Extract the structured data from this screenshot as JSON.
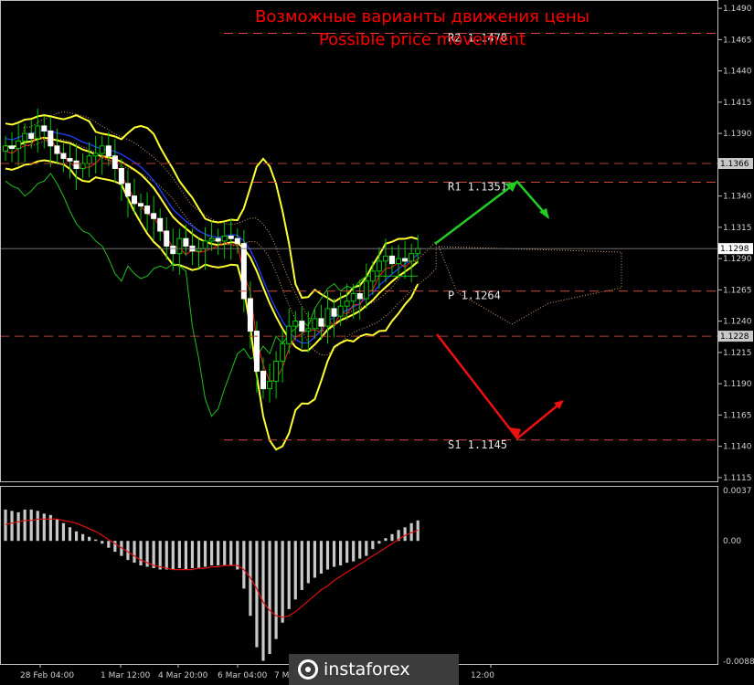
{
  "title_ru": "Возможные варианты движения цены",
  "title_en": "Possible price movement",
  "brand": "instaforex",
  "chart_data": {
    "type": "candlestick",
    "y_axis": {
      "ticks": [
        "1.1490",
        "1.1465",
        "1.1440",
        "1.1415",
        "1.1390",
        "1.1365",
        "1.1340",
        "1.1315",
        "1.1290",
        "1.1265",
        "1.1240",
        "1.1215",
        "1.1190",
        "1.1165",
        "1.1140",
        "1.1115"
      ],
      "range": [
        1.1112,
        1.1493
      ]
    },
    "x_labels": [
      "28 Feb 04:00",
      "1 Mar 12:00",
      "4 Mar 20:00",
      "6 Mar 04:00",
      "7 Mar 12:00",
      "12:00"
    ],
    "current_price": "1.1298",
    "price_tags": [
      {
        "value": "1.1366",
        "color": "#c8c8c8"
      },
      {
        "value": "1.1298",
        "color": "#ffffff"
      },
      {
        "value": "1.1228",
        "color": "#c8c8c8"
      }
    ],
    "levels": [
      {
        "name": "R2",
        "label": "R2 1.1470",
        "value": 1.147
      },
      {
        "name": "R1",
        "label": "R1 1.1351",
        "value": 1.1351
      },
      {
        "name": "P",
        "label": "P 1.1264",
        "value": 1.1264
      },
      {
        "name": "S1",
        "label": "S1 1.1145",
        "value": 1.1145
      }
    ],
    "extra_lines": [
      1.1366,
      1.1228
    ],
    "candles_close": [
      1.138,
      1.1378,
      1.1384,
      1.139,
      1.1386,
      1.1396,
      1.1392,
      1.138,
      1.1374,
      1.137,
      1.1368,
      1.1362,
      1.1366,
      1.1372,
      1.1374,
      1.138,
      1.1372,
      1.1362,
      1.135,
      1.134,
      1.1334,
      1.1332,
      1.1326,
      1.1322,
      1.1312,
      1.13,
      1.1294,
      1.1306,
      1.13,
      1.1296,
      1.1298,
      1.1304,
      1.1306,
      1.1304,
      1.1308,
      1.1306,
      1.1302,
      1.1258,
      1.1232,
      1.12,
      1.1186,
      1.1192,
      1.1208,
      1.1222,
      1.1236,
      1.124,
      1.1232,
      1.1234,
      1.1242,
      1.1236,
      1.125,
      1.1244,
      1.1252,
      1.1256,
      1.1262,
      1.1258,
      1.1272,
      1.128,
      1.1288,
      1.1292,
      1.1286,
      1.129,
      1.1288,
      1.1294,
      1.1298
    ],
    "macd": {
      "ticks": [
        "0.0037",
        "0.00",
        "-0.00883"
      ],
      "range": [
        -0.00883,
        0.0037
      ],
      "histogram": [
        0.0023,
        0.0022,
        0.0021,
        0.0023,
        0.0023,
        0.0022,
        0.002,
        0.0019,
        0.0016,
        0.0013,
        0.001,
        0.0007,
        0.0005,
        0.0003,
        0.0001,
        -0.0002,
        -0.0005,
        -0.0008,
        -0.0011,
        -0.0014,
        -0.0016,
        -0.0018,
        -0.0019,
        -0.002,
        -0.0021,
        -0.0021,
        -0.0021,
        -0.002,
        -0.0021,
        -0.002,
        -0.002,
        -0.0019,
        -0.0018,
        -0.0018,
        -0.0018,
        -0.0018,
        -0.0021,
        -0.0035,
        -0.0055,
        -0.0078,
        -0.0088,
        -0.0083,
        -0.0072,
        -0.006,
        -0.005,
        -0.0043,
        -0.0036,
        -0.0031,
        -0.0027,
        -0.0024,
        -0.0021,
        -0.0019,
        -0.0018,
        -0.0016,
        -0.0015,
        -0.0013,
        -0.0011,
        -0.0006,
        -0.0002,
        0.0002,
        0.0005,
        0.0008,
        0.001,
        0.0013,
        0.0015
      ],
      "signal": [
        0.0012,
        0.0013,
        0.0014,
        0.0015,
        0.0015,
        0.0016,
        0.0016,
        0.0016,
        0.0016,
        0.0015,
        0.0014,
        0.0013,
        0.0011,
        0.0009,
        0.0007,
        0.0004,
        0.0001,
        -0.0002,
        -0.0005,
        -0.0008,
        -0.0011,
        -0.0014,
        -0.0016,
        -0.0018,
        -0.0019,
        -0.002,
        -0.0021,
        -0.0021,
        -0.0021,
        -0.0021,
        -0.002,
        -0.002,
        -0.0019,
        -0.0019,
        -0.0018,
        -0.0018,
        -0.0018,
        -0.0021,
        -0.0027,
        -0.0035,
        -0.0045,
        -0.0051,
        -0.0055,
        -0.0056,
        -0.0055,
        -0.0052,
        -0.0048,
        -0.0044,
        -0.004,
        -0.0036,
        -0.0033,
        -0.0029,
        -0.0026,
        -0.0023,
        -0.002,
        -0.0017,
        -0.0014,
        -0.0011,
        -0.0008,
        -0.0005,
        -0.0002,
        0.0001,
        0.0004,
        0.0006,
        0.0008
      ]
    }
  }
}
